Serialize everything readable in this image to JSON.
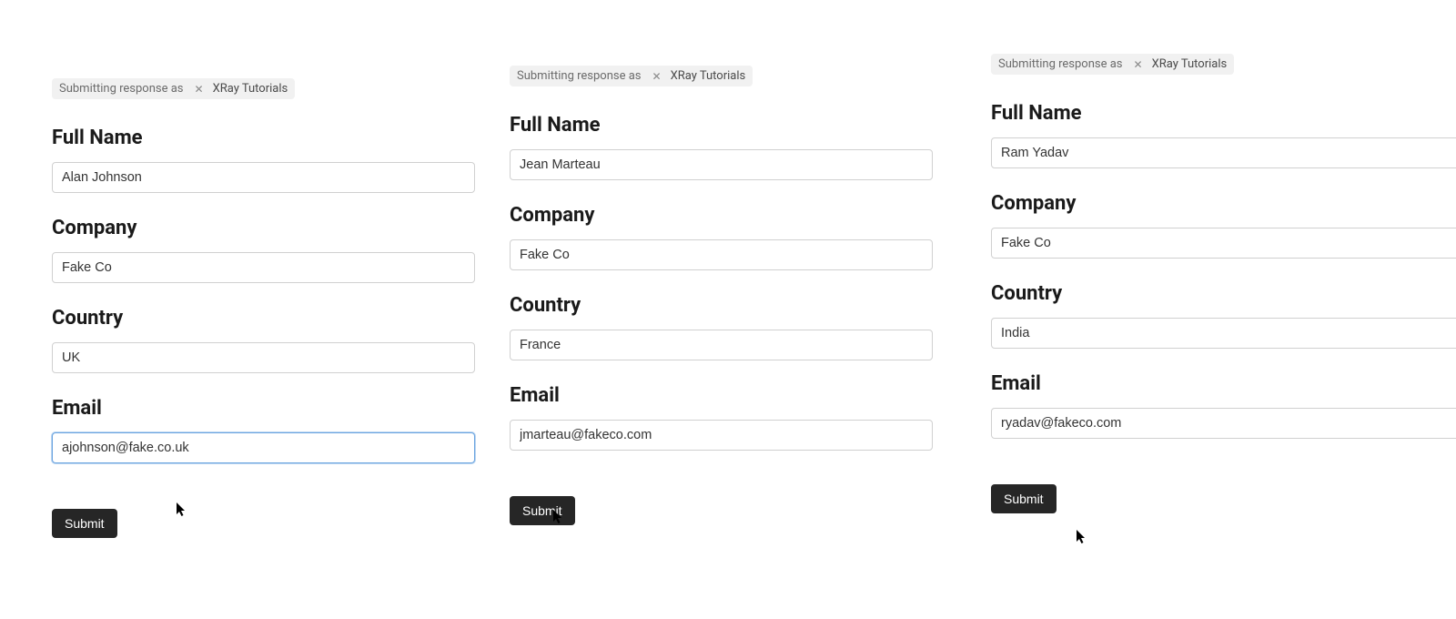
{
  "panels": [
    {
      "tag_label": "Submitting response as",
      "tag_value": "XRay Tutorials",
      "fields": {
        "full_name": {
          "label": "Full Name",
          "value": "Alan Johnson"
        },
        "company": {
          "label": "Company",
          "value": "Fake Co"
        },
        "country": {
          "label": "Country",
          "value": "UK"
        },
        "email": {
          "label": "Email",
          "value": "ajohnson@fake.co.uk",
          "focused": true
        }
      },
      "submit_label": "Submit"
    },
    {
      "tag_label": "Submitting response as",
      "tag_value": "XRay Tutorials",
      "fields": {
        "full_name": {
          "label": "Full Name",
          "value": "Jean Marteau"
        },
        "company": {
          "label": "Company",
          "value": "Fake Co"
        },
        "country": {
          "label": "Country",
          "value": "France"
        },
        "email": {
          "label": "Email",
          "value": "jmarteau@fakeco.com"
        }
      },
      "submit_label": "Submit"
    },
    {
      "tag_label": "Submitting response as",
      "tag_value": "XRay Tutorials",
      "fields": {
        "full_name": {
          "label": "Full Name",
          "value": "Ram Yadav"
        },
        "company": {
          "label": "Company",
          "value": "Fake Co"
        },
        "country": {
          "label": "Country",
          "value": "India"
        },
        "email": {
          "label": "Email",
          "value": "ryadav@fakeco.com"
        }
      },
      "submit_label": "Submit"
    }
  ]
}
